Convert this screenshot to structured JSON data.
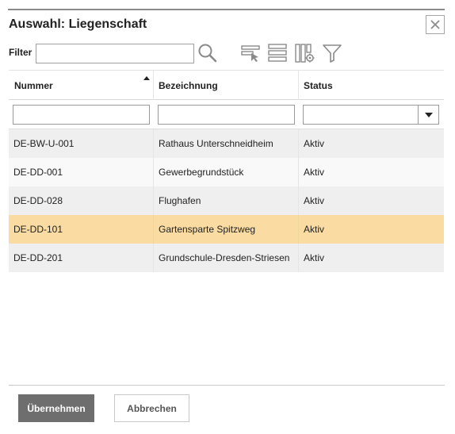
{
  "dialog": {
    "title": "Auswahl: Liegenschaft"
  },
  "toolbar": {
    "filter_label": "Filter",
    "filter_value": "",
    "icons": [
      "search-icon",
      "column-chooser-icon",
      "rows-icon",
      "column-settings-icon",
      "filter-funnel-icon"
    ]
  },
  "grid": {
    "columns": [
      {
        "label": "Nummer",
        "sorted": "ascending"
      },
      {
        "label": "Bezeichnung"
      },
      {
        "label": "Status"
      }
    ],
    "rows": [
      {
        "nummer": "DE-BW-U-001",
        "bezeichnung": "Rathaus Unterschneidheim",
        "status": "Aktiv"
      },
      {
        "nummer": "DE-DD-001",
        "bezeichnung": "Gewerbegrundstück",
        "status": "Aktiv"
      },
      {
        "nummer": "DE-DD-028",
        "bezeichnung": "Flughafen",
        "status": "Aktiv"
      },
      {
        "nummer": "DE-DD-101",
        "bezeichnung": "Gartensparte Spitzweg",
        "status": "Aktiv",
        "selected": true
      },
      {
        "nummer": "DE-DD-201",
        "bezeichnung": "Grundschule-Dresden-Striesen",
        "status": "Aktiv"
      }
    ]
  },
  "footer": {
    "accept_label": "Übernehmen",
    "cancel_label": "Abbrechen"
  },
  "colors": {
    "selected_row": "#fadca2",
    "primary_button": "#6e6e6e"
  }
}
